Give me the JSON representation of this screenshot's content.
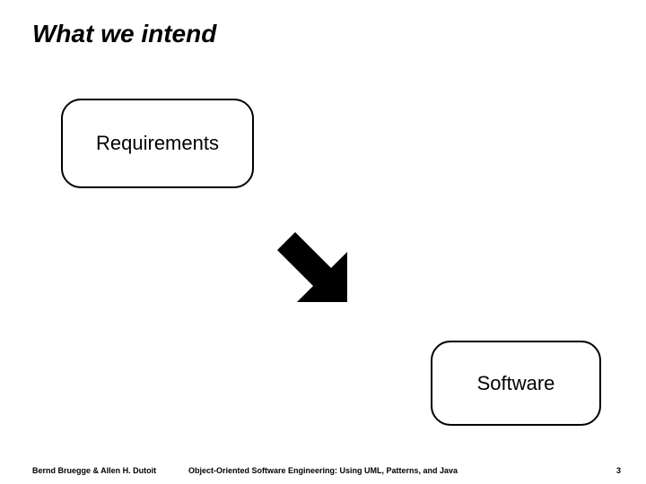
{
  "title": "What we intend",
  "boxes": {
    "requirements": "Requirements",
    "software": "Software"
  },
  "footer": {
    "left": "Bernd Bruegge & Allen H. Dutoit",
    "center": "Object-Oriented Software Engineering: Using UML, Patterns, and Java",
    "right": "3"
  }
}
